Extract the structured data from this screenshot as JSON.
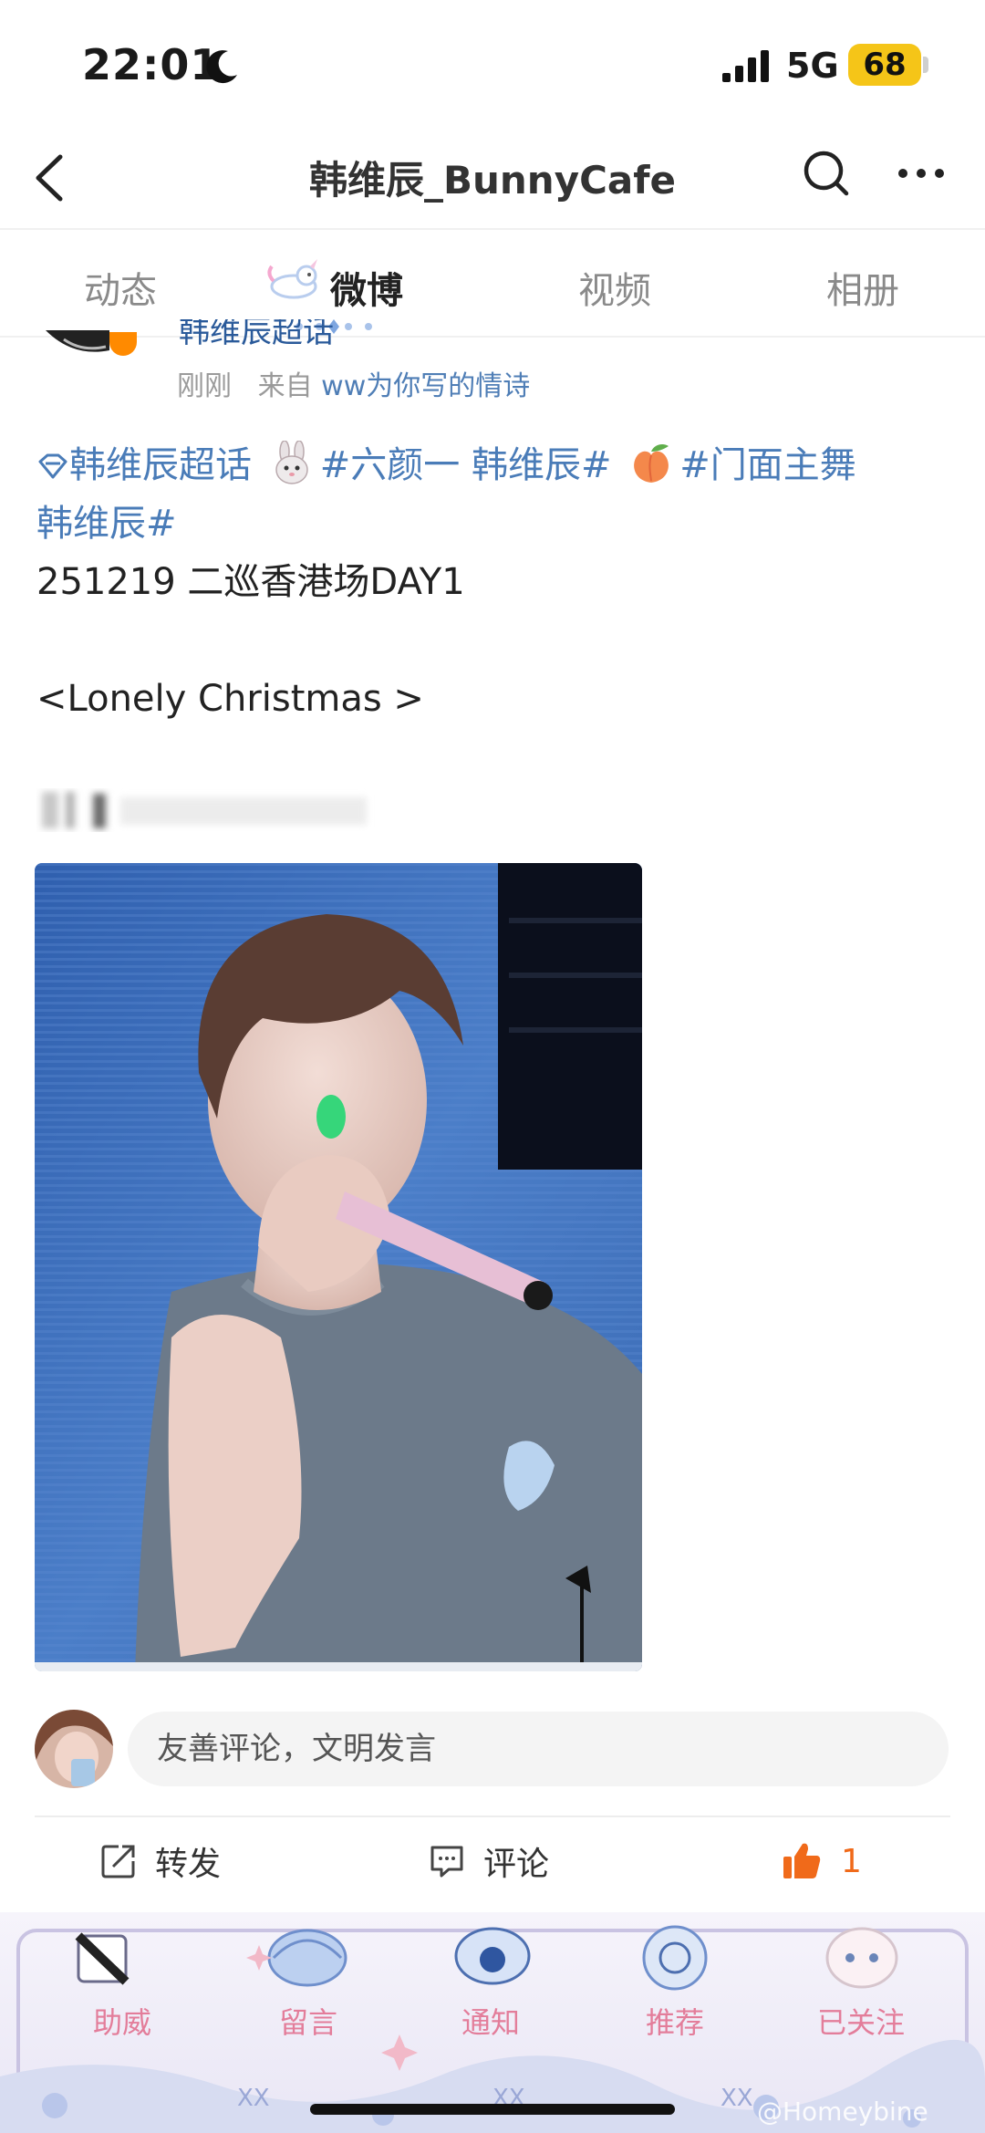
{
  "status_bar": {
    "time": "22:01",
    "network": "5G",
    "battery": "68"
  },
  "nav": {
    "title": "韩维辰_BunnyCafe"
  },
  "tabs": [
    {
      "label": "动态"
    },
    {
      "label": "微博"
    },
    {
      "label": "视频"
    },
    {
      "label": "相册"
    }
  ],
  "post": {
    "author": "韩维辰超话",
    "time": "刚刚",
    "source_prefix": "来自",
    "source": "ww为你写的情诗",
    "tags": {
      "super_topic": "韩维辰超话",
      "tag1": "#六颜一 韩维辰#",
      "tag2_part1": "#门面主舞",
      "tag2_part2": "韩维辰#"
    },
    "line1": "251219 二巡香港场DAY1",
    "line2": "<Lonely Christmas >"
  },
  "comment": {
    "placeholder": "友善评论，文明发言"
  },
  "actions": {
    "repost": "转发",
    "comment": "评论",
    "like_count": "1"
  },
  "bottom_bar": {
    "items": [
      "助威",
      "留言",
      "通知",
      "推荐",
      "已关注"
    ],
    "watermark": "@Homeybine"
  },
  "colors": {
    "link": "#4a7cb8",
    "like": "#f06a1a",
    "badge": "#f5c518"
  }
}
